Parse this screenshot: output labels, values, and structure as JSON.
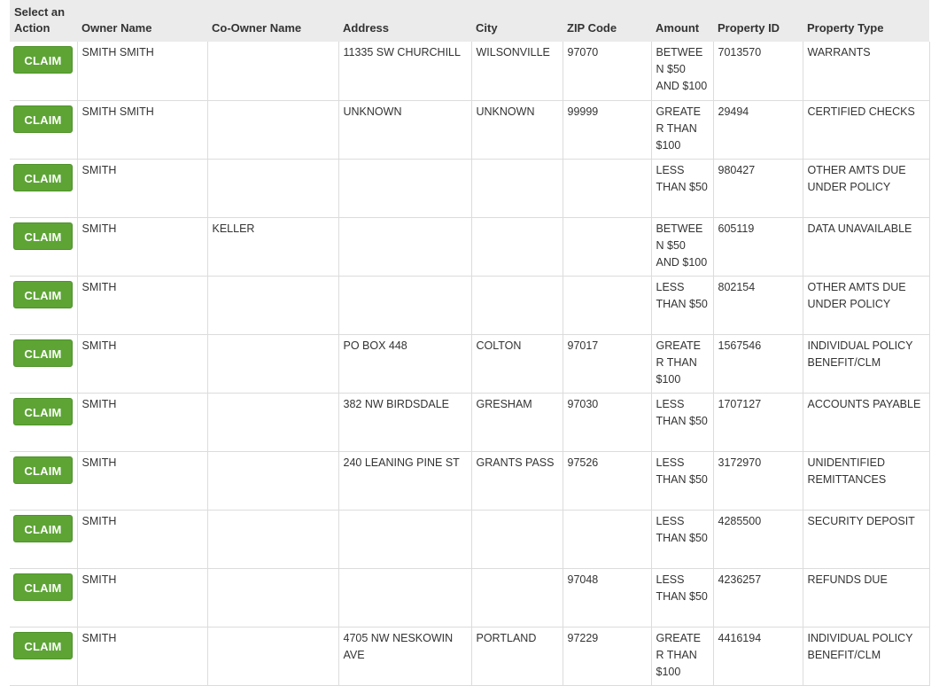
{
  "table": {
    "headers": {
      "action": "Select an Action",
      "owner": "Owner Name",
      "coowner": "Co-Owner Name",
      "address": "Address",
      "city": "City",
      "zip": "ZIP Code",
      "amount": "Amount",
      "property_id": "Property ID",
      "property_type": "Property Type"
    },
    "claim_label": "CLAIM",
    "rows": [
      {
        "owner": "SMITH SMITH",
        "coowner": "",
        "address": "11335 SW CHURCHILL",
        "city": "WILSONVILLE",
        "zip": "97070",
        "amount": "BETWEEN $50 AND $100",
        "property_id": "7013570",
        "property_type": "WARRANTS"
      },
      {
        "owner": "SMITH SMITH",
        "coowner": "",
        "address": "UNKNOWN",
        "city": "UNKNOWN",
        "zip": "99999",
        "amount": "GREATER THAN $100",
        "property_id": "29494",
        "property_type": "CERTIFIED CHECKS"
      },
      {
        "owner": "SMITH",
        "coowner": "",
        "address": "",
        "city": "",
        "zip": "",
        "amount": "LESS THAN $50",
        "property_id": "980427",
        "property_type": "OTHER AMTS DUE UNDER POLICY"
      },
      {
        "owner": "SMITH",
        "coowner": "KELLER",
        "address": "",
        "city": "",
        "zip": "",
        "amount": "BETWEEN $50 AND $100",
        "property_id": "605119",
        "property_type": "DATA UNAVAILABLE"
      },
      {
        "owner": "SMITH",
        "coowner": "",
        "address": "",
        "city": "",
        "zip": "",
        "amount": "LESS THAN $50",
        "property_id": "802154",
        "property_type": "OTHER AMTS DUE UNDER POLICY"
      },
      {
        "owner": "SMITH",
        "coowner": "",
        "address": "PO BOX 448",
        "city": "COLTON",
        "zip": "97017",
        "amount": "GREATER THAN $100",
        "property_id": "1567546",
        "property_type": "INDIVIDUAL POLICY BENEFIT/CLM"
      },
      {
        "owner": "SMITH",
        "coowner": "",
        "address": "382 NW BIRDSDALE",
        "city": "GRESHAM",
        "zip": "97030",
        "amount": "LESS THAN $50",
        "property_id": "1707127",
        "property_type": "ACCOUNTS PAYABLE"
      },
      {
        "owner": "SMITH",
        "coowner": "",
        "address": "240 LEANING PINE ST",
        "city": "GRANTS PASS",
        "zip": "97526",
        "amount": "LESS THAN $50",
        "property_id": "3172970",
        "property_type": "UNIDENTIFIED REMITTANCES"
      },
      {
        "owner": "SMITH",
        "coowner": "",
        "address": "",
        "city": "",
        "zip": "",
        "amount": "LESS THAN $50",
        "property_id": "4285500",
        "property_type": "SECURITY DEPOSIT"
      },
      {
        "owner": "SMITH",
        "coowner": "",
        "address": "",
        "city": "",
        "zip": "97048",
        "amount": "LESS THAN $50",
        "property_id": "4236257",
        "property_type": "REFUNDS DUE"
      },
      {
        "owner": "SMITH",
        "coowner": "",
        "address": "4705 NW NESKOWIN AVE",
        "city": "PORTLAND",
        "zip": "97229",
        "amount": "GREATER THAN $100",
        "property_id": "4416194",
        "property_type": "INDIVIDUAL POLICY BENEFIT/CLM"
      }
    ]
  },
  "colors": {
    "claim_button_bg": "#5da435",
    "header_bg": "#ebebeb",
    "border": "#dcdcdc"
  }
}
